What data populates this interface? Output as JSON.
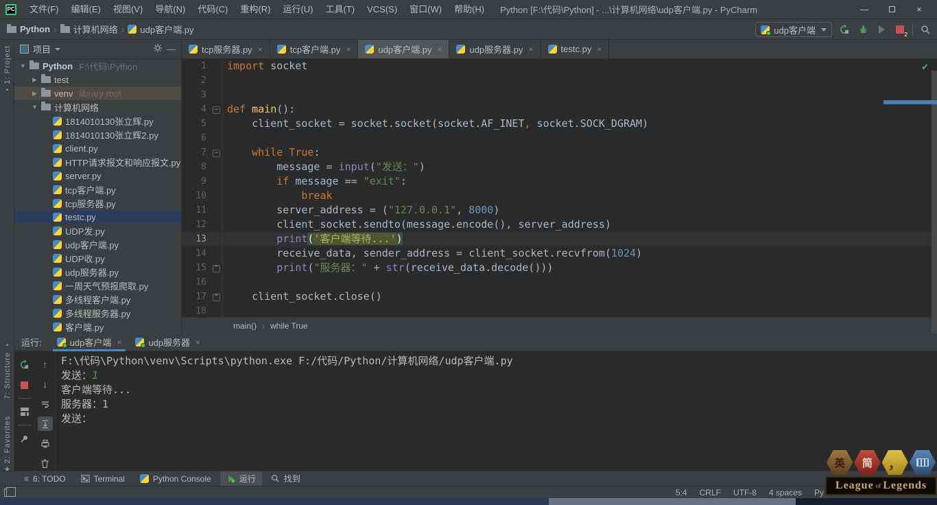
{
  "title_bar": {
    "logo": "PC",
    "menus": [
      "文件(F)",
      "编辑(E)",
      "视图(V)",
      "导航(N)",
      "代码(C)",
      "重构(R)",
      "运行(U)",
      "工具(T)",
      "VCS(S)",
      "窗口(W)",
      "帮助(H)"
    ],
    "title": "Python [F:\\代码\\Python] - ...\\计算机网络\\udp客户端.py - PyCharm"
  },
  "toolbar": {
    "breadcrumbs": [
      {
        "label": "Python",
        "icon": "folder",
        "bold": true
      },
      {
        "label": "计算机网络",
        "icon": "folder"
      },
      {
        "label": "udp客户端.py",
        "icon": "python"
      }
    ],
    "run_config": {
      "label": "udp客户端"
    },
    "stop_badge": "2"
  },
  "left_stripe": {
    "top": [
      {
        "label": "1: Project"
      }
    ],
    "bottom": [
      {
        "label": "7: Structure"
      },
      {
        "label": "2: Favorites"
      }
    ]
  },
  "project_panel": {
    "header_title": "项目",
    "tree": [
      {
        "depth": 0,
        "arrow": "down",
        "icon": "folder",
        "label": "Python",
        "suffix": "F:\\代码\\Python",
        "bold": true
      },
      {
        "depth": 1,
        "arrow": "right",
        "icon": "folder",
        "label": "test"
      },
      {
        "depth": 1,
        "arrow": "right",
        "icon": "folder",
        "label": "venv",
        "suffix": "library root",
        "hovered": true
      },
      {
        "depth": 1,
        "arrow": "down",
        "icon": "folder",
        "label": "计算机网络"
      },
      {
        "depth": 2,
        "icon": "python",
        "label": "1814010130张立辉.py"
      },
      {
        "depth": 2,
        "icon": "python",
        "label": "1814010130张立辉2.py"
      },
      {
        "depth": 2,
        "icon": "python",
        "label": "client.py"
      },
      {
        "depth": 2,
        "icon": "python",
        "label": "HTTP请求报文和响应报文.py"
      },
      {
        "depth": 2,
        "icon": "python",
        "label": "server.py"
      },
      {
        "depth": 2,
        "icon": "python",
        "label": "tcp客户端.py"
      },
      {
        "depth": 2,
        "icon": "python",
        "label": "tcp服务器.py"
      },
      {
        "depth": 2,
        "icon": "python",
        "label": "testc.py",
        "selected": true
      },
      {
        "depth": 2,
        "icon": "python",
        "label": "UDP发.py"
      },
      {
        "depth": 2,
        "icon": "python",
        "label": "udp客户端.py"
      },
      {
        "depth": 2,
        "icon": "python",
        "label": "UDP收.py"
      },
      {
        "depth": 2,
        "icon": "python",
        "label": "udp服务器.py"
      },
      {
        "depth": 2,
        "icon": "python",
        "label": "一周天气预报爬取.py"
      },
      {
        "depth": 2,
        "icon": "python",
        "label": "多线程客户端.py"
      },
      {
        "depth": 2,
        "icon": "python",
        "label": "多线程服务器.py"
      },
      {
        "depth": 2,
        "icon": "python",
        "label": "客户端.py"
      }
    ]
  },
  "editor": {
    "tabs": [
      {
        "label": "tcp服务器.py"
      },
      {
        "label": "tcp客户端.py"
      },
      {
        "label": "udp客户端.py",
        "active": true
      },
      {
        "label": "udp服务器.py"
      },
      {
        "label": "testc.py"
      }
    ],
    "lines": [
      {
        "n": 1,
        "tokens": [
          {
            "t": "import ",
            "c": "kw"
          },
          {
            "t": "socket",
            "c": "pl"
          }
        ]
      },
      {
        "n": 2,
        "tokens": []
      },
      {
        "n": 3,
        "tokens": []
      },
      {
        "n": 4,
        "fold": "minus",
        "tokens": [
          {
            "t": "def ",
            "c": "kw"
          },
          {
            "t": "main",
            "c": "fn"
          },
          {
            "t": "():",
            "c": "pl"
          }
        ]
      },
      {
        "n": 5,
        "tokens": [
          {
            "t": "    client_socket = socket.socket(socket.AF_INET",
            "c": "pl"
          },
          {
            "t": ", ",
            "c": "kw"
          },
          {
            "t": "socket.SOCK_DGRAM)",
            "c": "pl"
          }
        ]
      },
      {
        "n": 6,
        "tokens": []
      },
      {
        "n": 7,
        "fold": "minus",
        "tokens": [
          {
            "t": "    ",
            "c": "pl"
          },
          {
            "t": "while True",
            "c": "kw"
          },
          {
            "t": ":",
            "c": "pl"
          }
        ]
      },
      {
        "n": 8,
        "tokens": [
          {
            "t": "        message = ",
            "c": "pl"
          },
          {
            "t": "input",
            "c": "bi"
          },
          {
            "t": "(",
            "c": "pl"
          },
          {
            "t": "\"发送：\"",
            "c": "str"
          },
          {
            "t": ")",
            "c": "pl"
          }
        ]
      },
      {
        "n": 9,
        "tokens": [
          {
            "t": "        ",
            "c": "pl"
          },
          {
            "t": "if ",
            "c": "kw"
          },
          {
            "t": "message == ",
            "c": "pl"
          },
          {
            "t": "\"exit\"",
            "c": "str"
          },
          {
            "t": ":",
            "c": "pl"
          }
        ]
      },
      {
        "n": 10,
        "tokens": [
          {
            "t": "            ",
            "c": "pl"
          },
          {
            "t": "break",
            "c": "kw"
          }
        ]
      },
      {
        "n": 11,
        "tokens": [
          {
            "t": "        server_address = (",
            "c": "pl"
          },
          {
            "t": "\"127.0.0.1\"",
            "c": "str"
          },
          {
            "t": ", ",
            "c": "pl"
          },
          {
            "t": "8000",
            "c": "num"
          },
          {
            "t": ")",
            "c": "pl"
          }
        ]
      },
      {
        "n": 12,
        "tokens": [
          {
            "t": "        client_socket.sendto(message.encode(), server_address)",
            "c": "pl"
          }
        ]
      },
      {
        "n": 13,
        "current": true,
        "tokens": [
          {
            "t": "        ",
            "c": "pl"
          },
          {
            "t": "print",
            "c": "bi"
          },
          {
            "t": "(",
            "c": "br"
          },
          {
            "t": "'客户端等待...'",
            "c": "strhl"
          },
          {
            "t": ")",
            "c": "br"
          }
        ]
      },
      {
        "n": 14,
        "tokens": [
          {
            "t": "        receive_data, sender_address = client_socket.recvfrom(",
            "c": "pl"
          },
          {
            "t": "1024",
            "c": "num"
          },
          {
            "t": ")",
            "c": "pl"
          }
        ]
      },
      {
        "n": 15,
        "fold": "up",
        "tokens": [
          {
            "t": "        ",
            "c": "pl"
          },
          {
            "t": "print",
            "c": "bi"
          },
          {
            "t": "(",
            "c": "pl"
          },
          {
            "t": "\"服务器：\" ",
            "c": "str"
          },
          {
            "t": "+ ",
            "c": "pl"
          },
          {
            "t": "str",
            "c": "bi"
          },
          {
            "t": "(receive_data.decode()))",
            "c": "pl"
          }
        ]
      },
      {
        "n": 16,
        "tokens": []
      },
      {
        "n": 17,
        "fold": "up",
        "tokens": [
          {
            "t": "    client_socket.close()",
            "c": "pl"
          }
        ]
      },
      {
        "n": 18,
        "tokens": []
      }
    ],
    "breadcrumb": [
      "main()",
      "while True"
    ]
  },
  "run_panel": {
    "label": "运行:",
    "tabs": [
      {
        "label": "udp客户端",
        "active": true
      },
      {
        "label": "udp服务器"
      }
    ],
    "toolbar1": [
      "rerun",
      "stop",
      "sep",
      "layout",
      "sep",
      "pin"
    ],
    "toolbar2": [
      "up",
      "down",
      "softwrap",
      "scrollend",
      "print",
      "trash"
    ],
    "console": [
      {
        "tokens": [
          {
            "t": "F:\\代码\\Python\\venv\\Scripts\\python.exe F:/代码/Python/计算机网络/udp客户端.py",
            "c": "out"
          }
        ]
      },
      {
        "tokens": [
          {
            "t": "发送：",
            "c": "out"
          },
          {
            "t": "1",
            "c": "input"
          }
        ]
      },
      {
        "tokens": [
          {
            "t": "客户端等待...",
            "c": "out"
          }
        ]
      },
      {
        "tokens": [
          {
            "t": "服务器：1",
            "c": "out"
          }
        ]
      },
      {
        "tokens": [
          {
            "t": "发送：",
            "c": "out"
          }
        ]
      }
    ]
  },
  "bottom_bar": {
    "items": [
      {
        "label": "6: TODO",
        "icon": "todo"
      },
      {
        "label": "Terminal",
        "icon": "terminal"
      },
      {
        "label": "Python Console",
        "icon": "python"
      },
      {
        "label": "运行",
        "icon": "run",
        "active": true
      },
      {
        "label": "找到",
        "icon": "search"
      }
    ]
  },
  "status_bar": {
    "items": [
      "5:4",
      "CRLF",
      "UTF-8",
      "4 spaces",
      "Py"
    ]
  },
  "ime_overlay": {
    "badges": [
      {
        "label": "英",
        "style": "bronze"
      },
      {
        "label": "简",
        "style": "red"
      },
      {
        "label": "，",
        "style": "gold"
      },
      {
        "label": "",
        "style": "blue"
      }
    ],
    "logo": [
      "League",
      "of",
      "Legends"
    ]
  }
}
